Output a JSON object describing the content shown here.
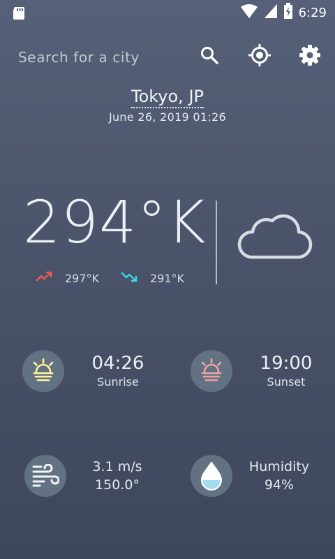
{
  "status_bar": {
    "time": "6:29",
    "icons": [
      "sd-card-icon",
      "wifi-icon",
      "cell-signal-icon",
      "battery-charging-icon"
    ]
  },
  "search": {
    "placeholder": "Search for a city",
    "icons": [
      "search-icon",
      "location-target-icon",
      "gear-icon"
    ]
  },
  "location": {
    "city": "Tokyo, JP",
    "datetime": "June 26, 2019 01:26"
  },
  "current": {
    "temperature": "294°K",
    "condition_icon": "cloud-icon",
    "max": "297°K",
    "min": "291°K"
  },
  "details": {
    "sunrise": {
      "time": "04:26",
      "label": "Sunrise"
    },
    "sunset": {
      "time": "19:00",
      "label": "Sunset"
    },
    "wind": {
      "speed": "3.1 m/s",
      "direction": "150.0°"
    },
    "humidity": {
      "label": "Humidity",
      "value": "94%"
    }
  },
  "colors": {
    "accent_up": "#ef5a5a",
    "accent_down": "#3ed6e6",
    "sunrise": "#fff59d",
    "sunset": "#f2a1a1",
    "tile_bg": "#627283"
  }
}
